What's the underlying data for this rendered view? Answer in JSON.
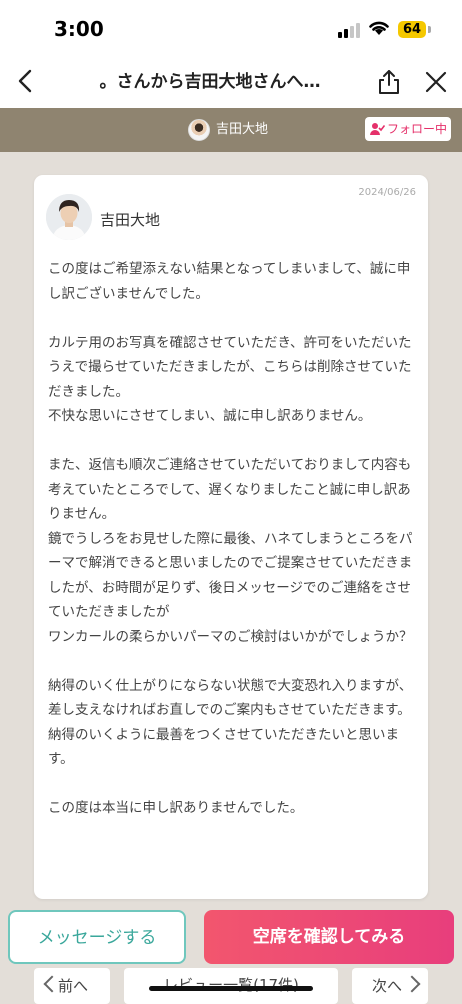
{
  "status_bar": {
    "time": "3:00",
    "battery": "64",
    "battery_color": "#f5c800"
  },
  "nav": {
    "title": "。さんから吉田大地さんへ…",
    "back_icon": "chevron-left-icon",
    "share_icon": "share-icon",
    "close_icon": "close-icon"
  },
  "stylist_bar": {
    "name": "吉田大地",
    "follow_label": "フォロー中",
    "follow_icon": "person-check-icon",
    "background": "#8f8470",
    "accent": "#e5306a"
  },
  "reply": {
    "date": "2024/06/26",
    "author": "吉田大地",
    "paragraphs": [
      "この度はご希望添えない結果となってしまいまして、誠に申し訳ございませんでした。",
      "カルテ用のお写真を確認させていただき、許可をいただいたうえで撮らせていただきましたが、こちらは削除させていただきました。\n不快な思いにさせてしまい、誠に申し訳ありません。",
      "また、返信も順次ご連絡させていただいておりまして内容も考えていたところでして、遅くなりましたこと誠に申し訳ありません。\n鏡でうしろをお見せした際に最後、ハネてしまうところをパーマで解消できると思いましたのでご提案させていただきましたが、お時間が足りず、後日メッセージでのご連絡をさせていただきましたが\nワンカールの柔らかいパーマのご検討はいかがでしょうか？",
      "納得のいく仕上がりにならない状態で大変恐れ入りますが、差し支えなければお直しでのご案内もさせていただきます。\n納得のいくように最善をつくさせていただきたいと思います。",
      "この度は本当に申し訳ありませんでした。"
    ]
  },
  "actions": {
    "message_label": "メッセージする",
    "availability_label": "空席を確認してみる",
    "message_color": "#3aa79b",
    "availability_color": "#e83e7c"
  },
  "pager": {
    "prev_label": "前へ",
    "list_label": "レビュー一覧(17件)",
    "next_label": "次へ"
  }
}
